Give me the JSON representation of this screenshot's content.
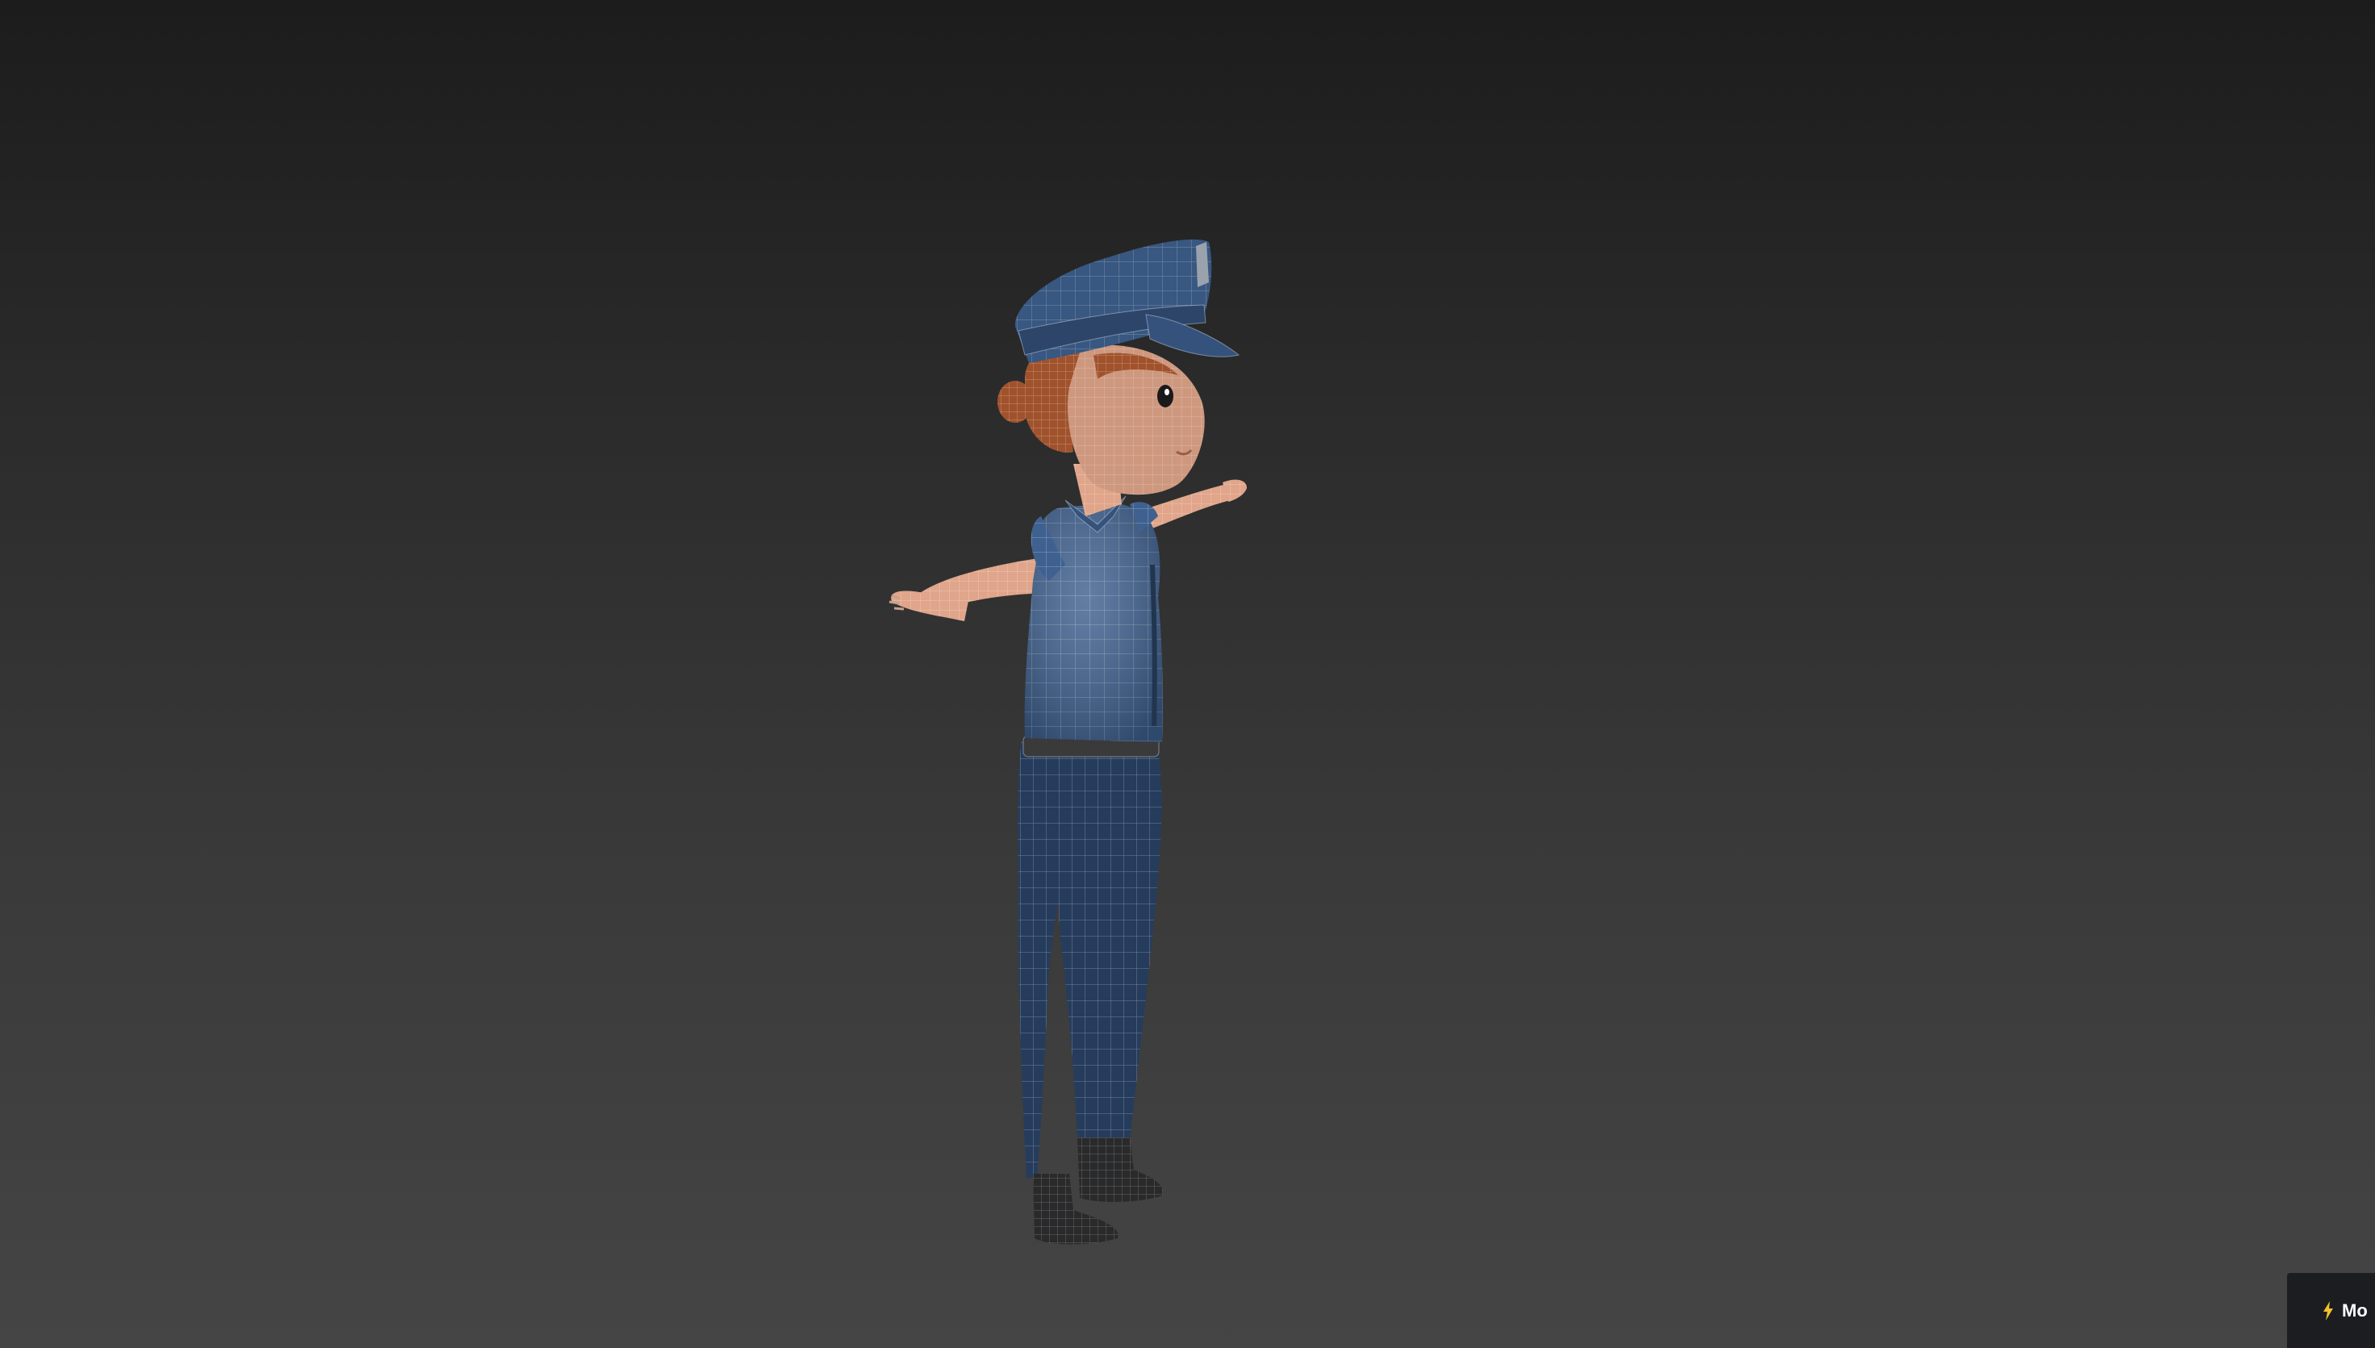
{
  "viewport": {
    "background_top": "#1c1c1c",
    "background_bottom": "#454545",
    "content": "3d-character-wireframe-shaded"
  },
  "model": {
    "uniform_color": "#3f6190",
    "skin_color": "#e0a58a",
    "hair_color": "#a0522d",
    "boot_color": "#2a2a2a",
    "wire_color": "#c8d3e0"
  },
  "badge": {
    "label": "Mo",
    "icon": "bolt-icon",
    "background": "#1b1d21"
  }
}
